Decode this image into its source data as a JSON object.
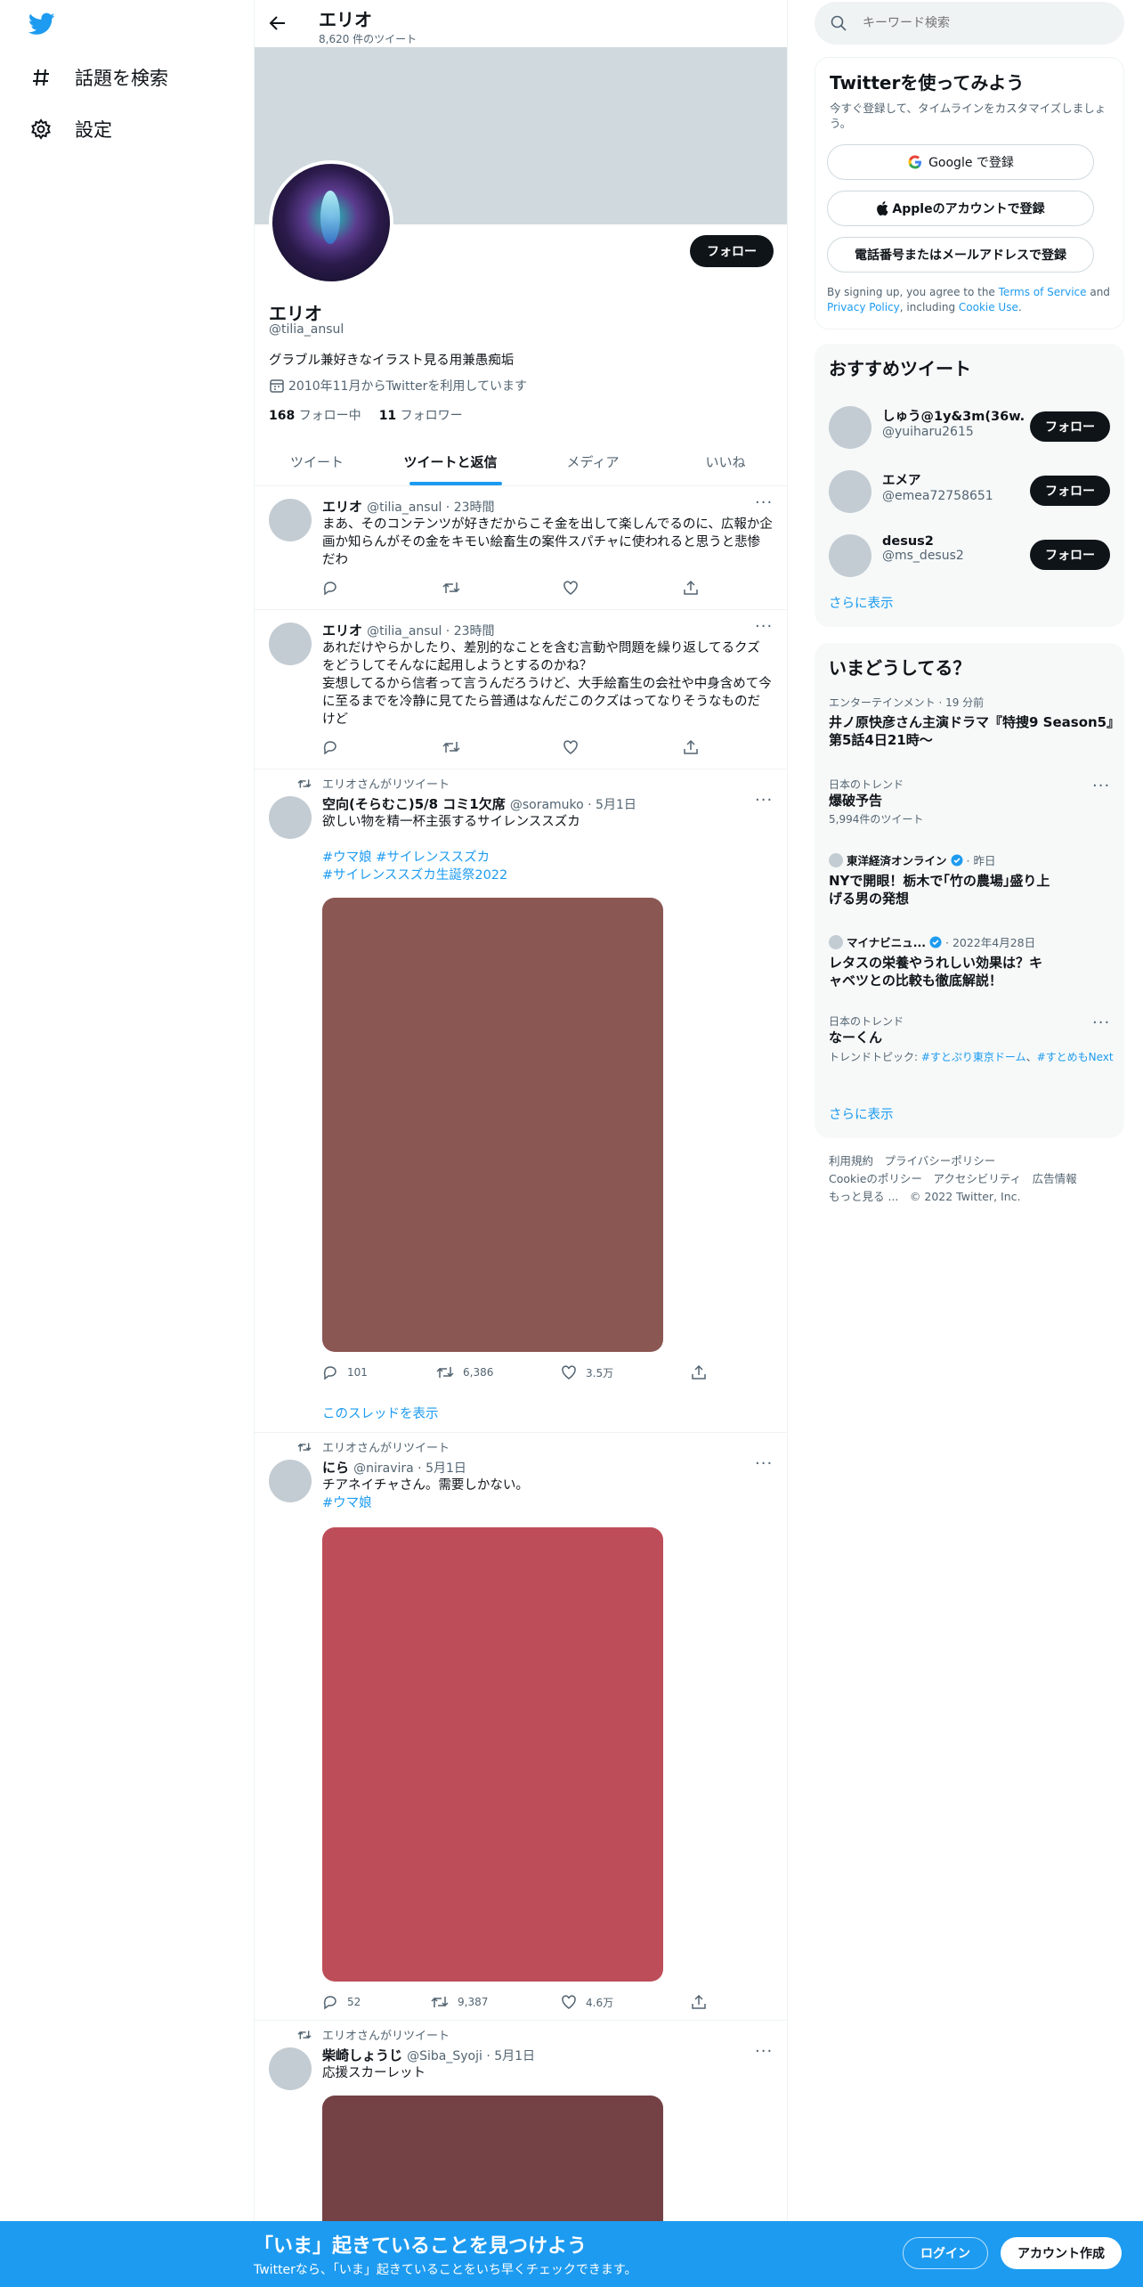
{
  "colors": {
    "accent": "#1d9bf0",
    "dark": "#0f1419",
    "muted": "#536471",
    "banner": "#cfd9de"
  },
  "nav": {
    "explore": "話題を検索",
    "settings": "設定"
  },
  "header": {
    "name": "エリオ",
    "tweet_count": "8,620 件のツイート"
  },
  "profile": {
    "follow_btn": "フォロー",
    "name": "エリオ",
    "handle": "@tilia_ansul",
    "bio": "グラブル兼好きなイラスト見る用兼愚痴垢",
    "joined": "2010年11月からTwitterを利用しています",
    "following_count": "168",
    "following_label": "フォロー中",
    "followers_count": "11",
    "followers_label": "フォロワー"
  },
  "tabs": [
    "ツイート",
    "ツイートと返信",
    "メディア",
    "いいね"
  ],
  "tweets": [
    {
      "name": "エリオ",
      "meta": "@tilia_ansul · 23時間",
      "text": "まあ、そのコンテンツが好きだからこそ金を出して楽しんでるのに、広報か企画か知らんがその金をキモい絵畜生の案件スパチャに使われると思うと悲惨だわ"
    },
    {
      "name": "エリオ",
      "meta": "@tilia_ansul · 23時間",
      "text": "あれだけやらかしたり、差別的なことを含む言動や問題を繰り返してるクズをどうしてそんなに起用しようとするのかね？\n妄想してるから信者って言うんだろうけど、大手絵畜生の会社や中身含めて今に至るまでを冷静に見てたら普通はなんだこのクズはってなりそうなものだけど"
    },
    {
      "retweet": "エリオさんがリツイート",
      "name": "空向(そらむこ)5/8 コミ1欠席",
      "meta": "@soramuko · 5月1日",
      "text": "欲しい物を精一杯主張するサイレンススズカ",
      "tags1": "#ウマ娘 #サイレンススズカ",
      "tags2": "#サイレンススズカ生誕祭2022",
      "replies": "101",
      "retweets": "6,386",
      "likes": "3.5万",
      "thread": "このスレッドを表示",
      "media_color": "#8b5753"
    },
    {
      "retweet": "エリオさんがリツイート",
      "name": "にら",
      "meta": "@niravira · 5月1日",
      "text": "チアネイチャさん。需要しかない。",
      "tags1": "#ウマ娘",
      "replies": "52",
      "retweets": "9,387",
      "likes": "4.6万",
      "media_color": "#bd4e59"
    },
    {
      "retweet": "エリオさんがリツイート",
      "name": "柴崎しょうじ",
      "meta": "@Siba_Syoji · 5月1日",
      "text": "応援スカーレット",
      "media_color": "#744245"
    }
  ],
  "search": {
    "placeholder": "キーワード検索"
  },
  "signup": {
    "title": "Twitterを使ってみよう",
    "subtitle": "今すぐ登録して、タイムラインをカスタマイズしましょう。",
    "google": "Google で登録",
    "apple": "Appleのアカウントで登録",
    "phone": "電話番号またはメールアドレスで登録",
    "legal_a": "By signing up, you agree to the ",
    "legal_tos": "Terms of Service",
    "legal_b": " and ",
    "legal_pp": "Privacy Policy",
    "legal_c": ", including ",
    "legal_cookie": "Cookie Use",
    "legal_d": "."
  },
  "who": {
    "title": "おすすめツイート",
    "users": [
      {
        "name": "しゅう@1y&3m(36w...",
        "handle": "@yuiharu2615"
      },
      {
        "name": "エメア",
        "handle": "@emea72758651"
      },
      {
        "name": "desus2",
        "handle": "@ms_desus2"
      }
    ],
    "follow": "フォロー",
    "more": "さらに表示"
  },
  "trends": {
    "title": "いまどうしてる？",
    "items": [
      {
        "cat": "エンターテインメント · 19 分前",
        "name": "井ノ原快彦さん主演ドラマ『特捜9 Season5』第5話4日21時〜"
      },
      {
        "cat": "日本のトレンド",
        "name": "爆破予告",
        "count": "5,994件のツイート"
      },
      {
        "source": "東洋経済オンライン",
        "time": "· 昨日",
        "name": "NYで開眼！栃木で｢竹の農場｣盛り上げる男の発想"
      },
      {
        "source": "マイナビニュ...",
        "time": "· 2022年4月28日",
        "name": "レタスの栄養やうれしい効果は？キャベツとの比較も徹底解説！"
      },
      {
        "cat": "日本のトレンド",
        "name": "なーくん",
        "topic_label": "トレンドトピック: ",
        "topic1": "#すとぷり東京ドーム",
        "topic_sep": "、",
        "topic2": "#すとめもNext"
      }
    ],
    "more": "さらに表示"
  },
  "footer": {
    "l1a": "利用規約",
    "l1b": "プライバシーポリシー",
    "l2a": "Cookieのポリシー",
    "l2b": "アクセシビリティ",
    "l2c": "広告情報",
    "l3a": "もっと見る ...",
    "l3b": "© 2022 Twitter, Inc."
  },
  "bottom": {
    "title": "「いま」起きていることを見つけよう",
    "subtitle": "Twitterなら、「いま」起きていることをいち早くチェックできます。",
    "login": "ログイン",
    "signup": "アカウント作成"
  }
}
